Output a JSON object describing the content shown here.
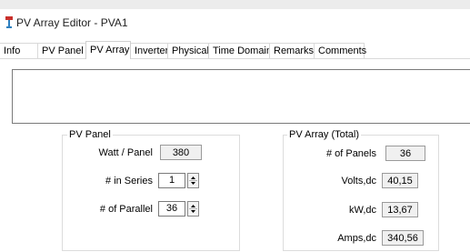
{
  "window": {
    "title": "PV Array Editor - PVA1"
  },
  "tabs": [
    {
      "label": "Info"
    },
    {
      "label": "PV Panel"
    },
    {
      "label": "PV Array"
    },
    {
      "label": "Inverter"
    },
    {
      "label": "Physical"
    },
    {
      "label": "Time Domain"
    },
    {
      "label": "Remarks"
    },
    {
      "label": "Comments"
    }
  ],
  "active_tab": "PV Array",
  "pv_panel": {
    "group_title": "PV Panel",
    "watt_label": "Watt / Panel",
    "watt_value": "380",
    "series_label": "# in Series",
    "series_value": "1",
    "parallel_label": "# of Parallel",
    "parallel_value": "36"
  },
  "pv_array": {
    "group_title": "PV Array (Total)",
    "panels_label": "# of Panels",
    "panels_value": "36",
    "volts_label": "Volts,dc",
    "volts_value": "40,15",
    "kw_label": "kW,dc",
    "kw_value": "13,67",
    "amps_label": "Amps,dc",
    "amps_value": "340,56"
  }
}
